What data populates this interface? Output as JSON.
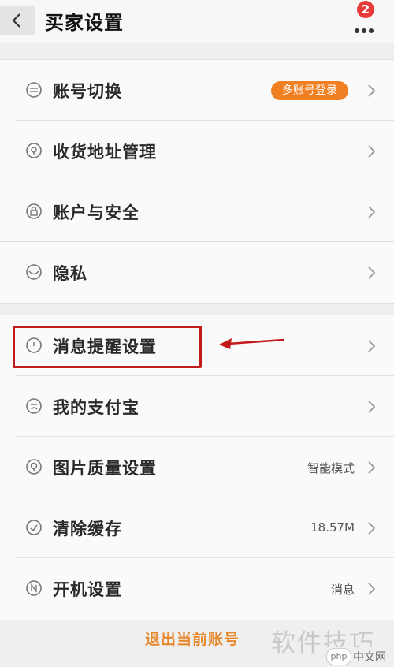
{
  "header": {
    "title": "买家设置",
    "badge_count": "2"
  },
  "rows": [
    {
      "label": "账号切换",
      "pill": "多账号登录",
      "value": ""
    },
    {
      "label": "收货地址管理",
      "value": ""
    },
    {
      "label": "账户与安全",
      "value": ""
    },
    {
      "label": "隐私",
      "value": ""
    },
    {
      "label": "消息提醒设置",
      "value": ""
    },
    {
      "label": "我的支付宝",
      "value": ""
    },
    {
      "label": "图片质量设置",
      "value": "智能模式"
    },
    {
      "label": "清除缓存",
      "value": "18.57M"
    },
    {
      "label": "开机设置",
      "value": "消息"
    }
  ],
  "footer": {
    "logout_label": "退出当前账号",
    "watermark": "软件技巧",
    "watermark_logo": "php",
    "watermark_site": "中文网"
  },
  "colors": {
    "accent": "#f07f22",
    "highlight_box": "#c21a1a",
    "badge": "#e83b3b"
  }
}
